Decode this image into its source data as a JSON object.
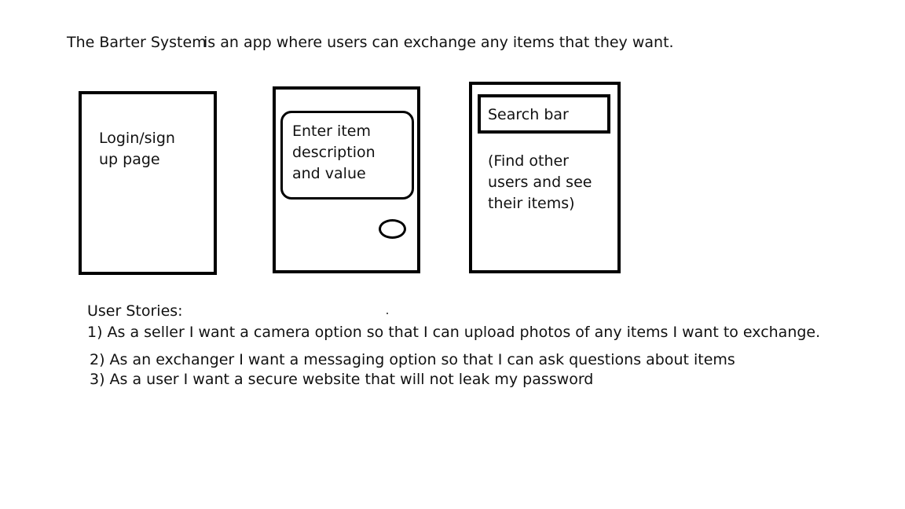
{
  "intro": {
    "title": "The Barter System",
    "text": "is an app where users can exchange any items that they want."
  },
  "screens": {
    "login": {
      "label": "Login/sign\nup page"
    },
    "item_entry": {
      "input_label": "Enter item\ndescription\nand value"
    },
    "search": {
      "search_bar_label": "Search bar",
      "description": "(Find other\nusers and see\ntheir items)"
    }
  },
  "user_stories": {
    "heading": "User Stories:",
    "items": [
      "1) As a seller I want a camera option so that I can upload photos of any items I want to exchange.",
      "2) As an exchanger I want a messaging option so that I can ask questions about items",
      "3) As a user I want a secure website that will not leak my password"
    ]
  }
}
